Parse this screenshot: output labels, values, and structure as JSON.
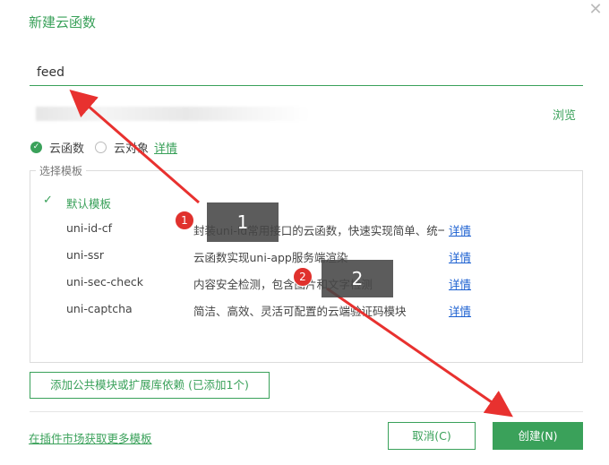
{
  "dialog": {
    "title": "新建云函数",
    "close_symbol": "✕"
  },
  "form": {
    "name_value": "feed",
    "path_text": "",
    "browse_label": "浏览"
  },
  "type_selector": {
    "options": [
      {
        "label": "云函数",
        "selected": true
      },
      {
        "label": "云对象",
        "selected": false
      }
    ],
    "detail_label": "详情"
  },
  "templates": {
    "legend": "选择模板",
    "items": [
      {
        "name": "默认模板",
        "desc": "",
        "more": "",
        "selected": true
      },
      {
        "name": "uni-id-cf",
        "desc": "封装uni-id常用接口的云函数，快速实现简单、统一、",
        "more": "详情",
        "selected": false
      },
      {
        "name": "uni-ssr",
        "desc": "云函数实现uni-app服务端渲染",
        "more": "详情",
        "selected": false
      },
      {
        "name": "uni-sec-check",
        "desc": "内容安全检测，包含图片和文字检测",
        "more": "详情",
        "selected": false
      },
      {
        "name": "uni-captcha",
        "desc": "简洁、高效、灵活可配置的云端验证码模块",
        "more": "详情",
        "selected": false
      }
    ]
  },
  "footer": {
    "add_module_label": "添加公共模块或扩展库依赖 (已添加1个)",
    "market_link_label": "在插件市场获取更多模板",
    "cancel_label": "取消(C)",
    "create_label": "创建(N)"
  },
  "annotations": {
    "callout_1": "1",
    "callout_2": "2",
    "badge_1": "1",
    "badge_2": "2",
    "color": "#e8312f"
  },
  "colors": {
    "accent": "#3aa15a",
    "link_blue": "#1a5fd0"
  }
}
